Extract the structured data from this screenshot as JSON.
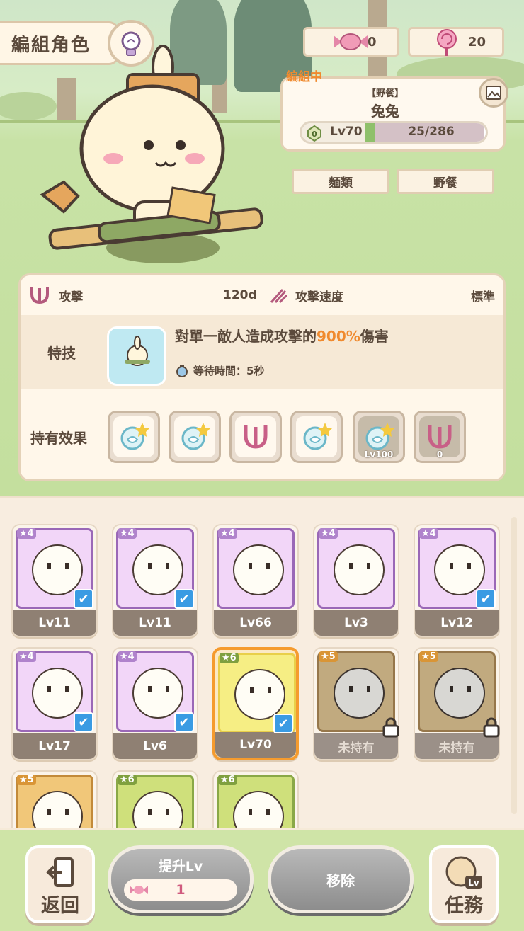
{
  "header": {
    "title": "編組角色",
    "hint_icon": "lightbulb-icon"
  },
  "currency": {
    "candy": {
      "icon": "candy-icon",
      "value": "0"
    },
    "lollipop": {
      "icon": "lollipop-icon",
      "value": "20"
    }
  },
  "character": {
    "status_tag": "編組中",
    "subtitle": "【野餐】",
    "name": "兔兔",
    "level": "Lv70",
    "exp_text": "25/286",
    "exp_fraction": 0.087,
    "tags": [
      "麵類",
      "野餐"
    ]
  },
  "stats": {
    "attack_label": "攻擊",
    "attack_value": "120d",
    "speed_label": "攻擊速度",
    "speed_value": "標準",
    "skill_label": "特技",
    "skill_desc_pre": "對單一敵人造成攻擊的",
    "skill_desc_pct": "900%",
    "skill_desc_post": "傷害",
    "wait_time": "等待時間：5秒",
    "effects_label": "持有效果",
    "effects": [
      {
        "icon": "shield-star-icon",
        "dim": false,
        "note": ""
      },
      {
        "icon": "shield-star-icon",
        "dim": false,
        "note": ""
      },
      {
        "icon": "claw-icon",
        "dim": false,
        "note": ""
      },
      {
        "icon": "shield-star-icon",
        "dim": false,
        "note": ""
      },
      {
        "icon": "shield-star-icon",
        "dim": true,
        "note": "Lv100"
      },
      {
        "icon": "claw-icon",
        "dim": true,
        "note": "0"
      }
    ]
  },
  "roster": [
    {
      "stars": "4",
      "level": "Lv11",
      "selected": true,
      "rarity": "purple",
      "state": "owned"
    },
    {
      "stars": "4",
      "level": "Lv11",
      "selected": true,
      "rarity": "purple",
      "state": "owned"
    },
    {
      "stars": "4",
      "level": "Lv66",
      "selected": false,
      "rarity": "purple",
      "state": "owned"
    },
    {
      "stars": "4",
      "level": "Lv3",
      "selected": false,
      "rarity": "purple",
      "state": "owned"
    },
    {
      "stars": "4",
      "level": "Lv12",
      "selected": true,
      "rarity": "purple",
      "state": "owned"
    },
    {
      "stars": "4",
      "level": "Lv17",
      "selected": true,
      "rarity": "purple",
      "state": "owned"
    },
    {
      "stars": "4",
      "level": "Lv6",
      "selected": true,
      "rarity": "purple",
      "state": "owned"
    },
    {
      "stars": "6",
      "level": "Lv70",
      "selected": true,
      "rarity": "green",
      "state": "current"
    },
    {
      "stars": "5",
      "level": "未持有",
      "selected": false,
      "rarity": "gold",
      "state": "locked"
    },
    {
      "stars": "5",
      "level": "未持有",
      "selected": false,
      "rarity": "gold",
      "state": "locked"
    },
    {
      "stars": "5",
      "level": "",
      "selected": false,
      "rarity": "gold",
      "state": "partial"
    },
    {
      "stars": "6",
      "level": "",
      "selected": false,
      "rarity": "green",
      "state": "partial"
    },
    {
      "stars": "6",
      "level": "",
      "selected": false,
      "rarity": "green",
      "state": "partial"
    }
  ],
  "bottom": {
    "back_label": "返回",
    "levelup_label": "提升Lv",
    "levelup_cost": "1",
    "remove_label": "移除",
    "mission_label": "任務",
    "mission_badge": "Lv"
  }
}
